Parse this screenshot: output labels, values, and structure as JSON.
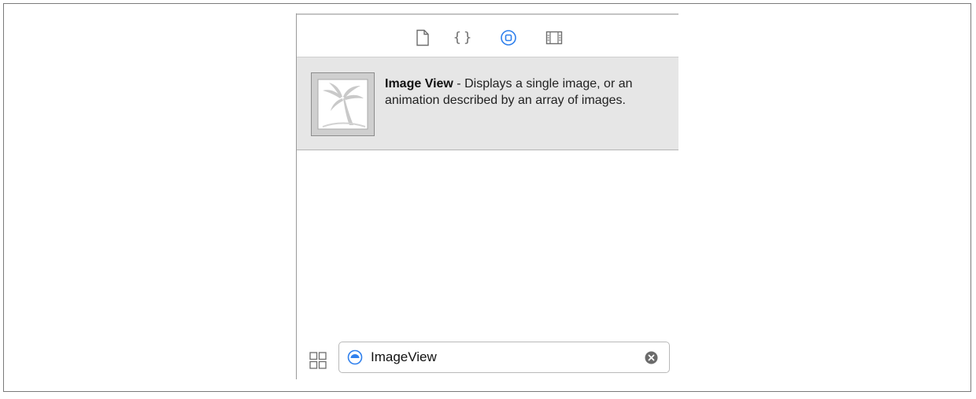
{
  "library": {
    "tabs": [
      {
        "icon": "file-template-icon",
        "active": false
      },
      {
        "icon": "code-snippet-icon",
        "label": "{}",
        "active": false
      },
      {
        "icon": "object-library-icon",
        "active": true
      },
      {
        "icon": "media-library-icon",
        "active": false
      }
    ],
    "item": {
      "icon": "image-view-icon",
      "title": "Image View",
      "description": " - Displays a single image, or an animation described by an array of images."
    },
    "filter": {
      "scope_icon": "filter-scope-icon",
      "value": "ImageView",
      "clear_icon": "clear-icon"
    },
    "view_toggle_icon": "grid-view-icon"
  },
  "colors": {
    "accent": "#2f80ed",
    "panel_item_bg": "#e6e6e6",
    "icon_gray": "#6d6d6d"
  }
}
